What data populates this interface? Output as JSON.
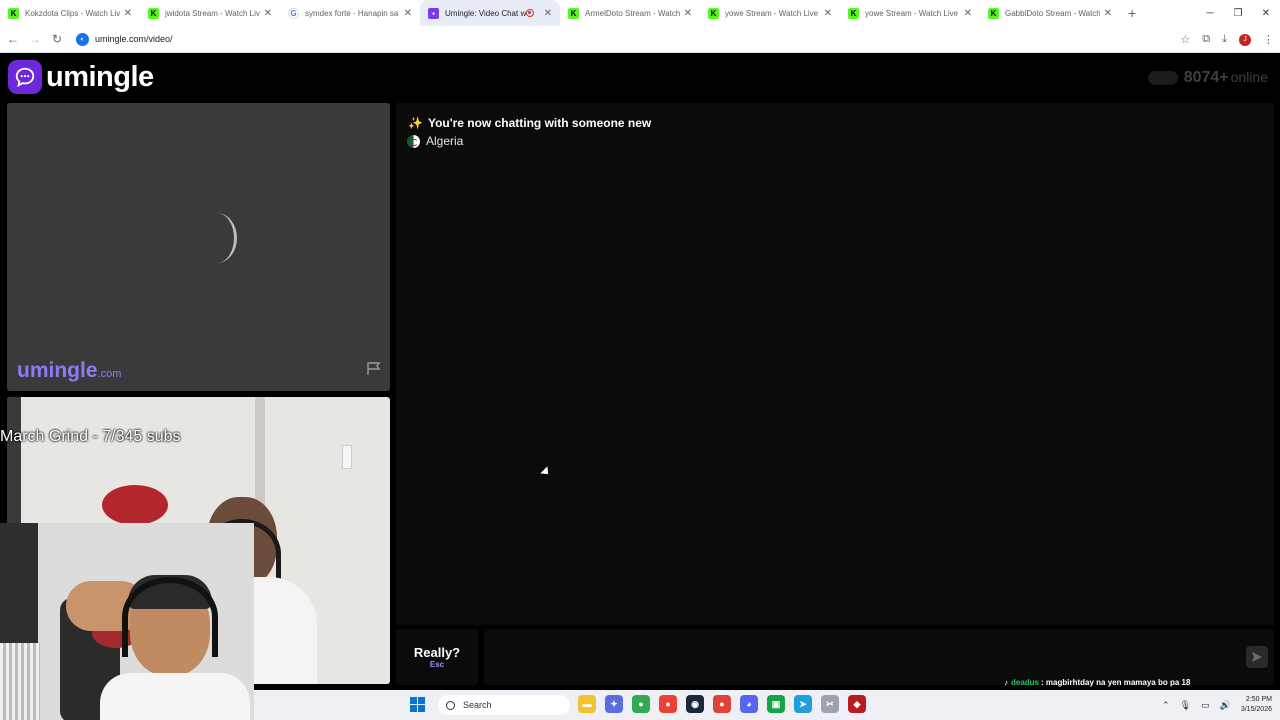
{
  "browser": {
    "tabs": [
      {
        "title": "Kokzdota Clips - Watch Live",
        "favicon": "kick-icon",
        "active": false
      },
      {
        "title": "jwidota Stream - Watch Live",
        "favicon": "kick-icon",
        "active": false
      },
      {
        "title": "symdex forte - Hanapin sa G",
        "favicon": "google-icon",
        "active": false
      },
      {
        "title": "Umingle: Video Chat with",
        "favicon": "umingle-icon",
        "active": true
      },
      {
        "title": "ArmelDoto Stream - Watch l",
        "favicon": "kick-icon",
        "active": false
      },
      {
        "title": "yowe Stream - Watch Live o",
        "favicon": "kick-icon",
        "active": false
      },
      {
        "title": "yowe Stream - Watch Live o",
        "favicon": "kick-icon",
        "active": false
      },
      {
        "title": "GabbiDoto Stream - Watch l",
        "favicon": "kick-icon",
        "active": false
      }
    ],
    "url": "umingle.com/video/",
    "profile_initial": "J"
  },
  "site": {
    "brand": "umingle",
    "online_count": "8074+",
    "online_suffix": "online",
    "watermark_main": "umingle",
    "watermark_tld": ".com"
  },
  "chat": {
    "status_line": "You're now chatting with someone new",
    "country": "Algeria",
    "esc_label": "Really?",
    "esc_key": "Esc",
    "input_value": ""
  },
  "stream_overlay": {
    "title": "March Grind - 7/345 subs",
    "ticker_user": "deadus",
    "ticker_message": ": magbirhtday na yen mamaya bo pa 18"
  },
  "taskbar": {
    "search_label": "Search",
    "time": "2:50 PM",
    "date": "3/15/2026"
  },
  "colors": {
    "brand_purple": "#6d28d9",
    "watermark_purple": "#8b7cf6",
    "chat_bg": "#0b0b0c"
  }
}
